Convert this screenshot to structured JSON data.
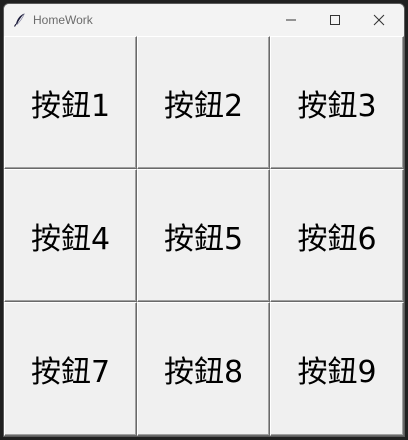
{
  "window": {
    "title": "HomeWork",
    "icon": "feather-icon",
    "controls": [
      "minimize-icon",
      "maximize-icon",
      "close-icon"
    ]
  },
  "buttons": [
    {
      "label": "按鈕1"
    },
    {
      "label": "按鈕2"
    },
    {
      "label": "按鈕3"
    },
    {
      "label": "按鈕4"
    },
    {
      "label": "按鈕5"
    },
    {
      "label": "按鈕6"
    },
    {
      "label": "按鈕7"
    },
    {
      "label": "按鈕8"
    },
    {
      "label": "按鈕9"
    }
  ]
}
